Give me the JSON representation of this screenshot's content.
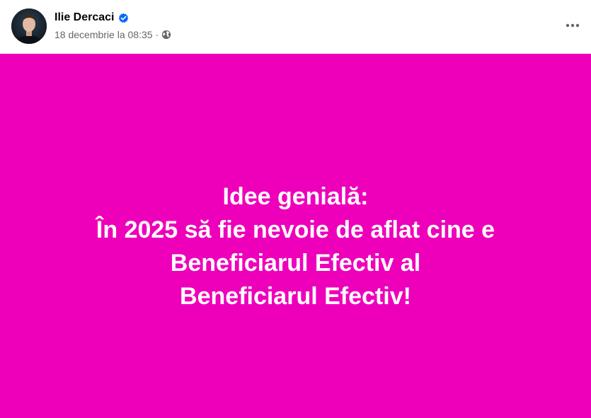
{
  "author": {
    "name": "Ilie Dercaci",
    "verified": true
  },
  "meta": {
    "timestamp": "18 decembrie la 08:35",
    "separator": "·",
    "audience_icon": "globe-icon"
  },
  "menu": {
    "icon": "more-horizontal-icon"
  },
  "post": {
    "background_color": "#ee00bb",
    "lines": [
      "Idee genială:",
      "În 2025 să fie nevoie de aflat cine e",
      "Beneficiarul Efectiv al",
      "Beneficiarul Efectiv!"
    ]
  },
  "colors": {
    "verified_badge": "#0866ff",
    "meta_text": "#65676b",
    "post_text": "#ffffff"
  }
}
